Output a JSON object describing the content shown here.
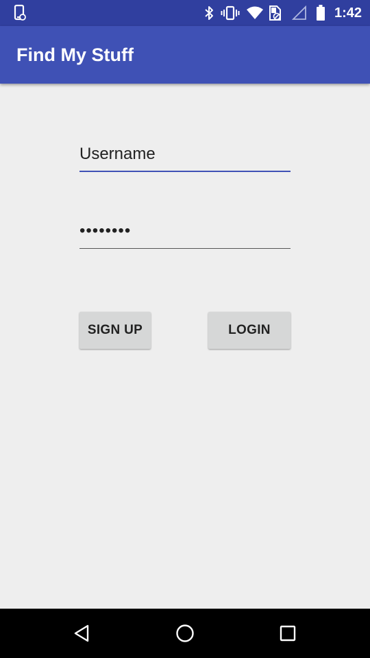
{
  "status_bar": {
    "time": "1:42",
    "icons": [
      "device-notification-icon",
      "bluetooth-icon",
      "vibrate-icon",
      "wifi-icon",
      "sim-card-icon",
      "no-signal-icon",
      "battery-icon"
    ]
  },
  "app_bar": {
    "title": "Find My Stuff"
  },
  "form": {
    "username": {
      "value": "Username"
    },
    "password": {
      "value": "••••••••"
    },
    "signup_label": "SIGN UP",
    "login_label": "LOGIN"
  },
  "nav_bar": {
    "icons": [
      "back-icon",
      "home-icon",
      "recents-icon"
    ]
  },
  "colors": {
    "primary": "#3F51B5",
    "primary_dark": "#303F9F",
    "background": "#EEEEEE",
    "button": "#D6D7D7"
  }
}
